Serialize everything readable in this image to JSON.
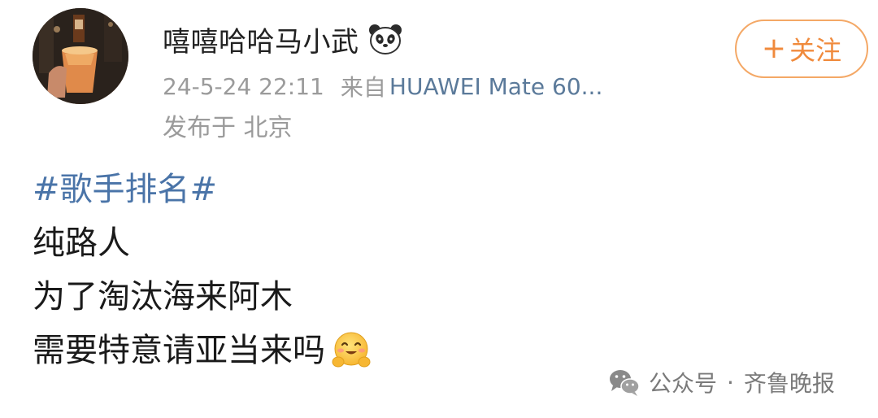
{
  "post": {
    "author": {
      "name": "嘻嘻哈哈马小武",
      "badge_icon": "panda-icon"
    },
    "time": "24-5-24 22:11",
    "source_prefix": "来自",
    "device": "HUAWEI Mate 60...",
    "location": "发布于 北京",
    "follow_button": {
      "plus": "+",
      "label": "关注"
    },
    "content": {
      "hashtag": "#歌手排名#",
      "lines": [
        "纯路人",
        "为了淘汰海来阿木",
        "需要特意请亚当来吗"
      ],
      "trailing_emoji": "hugging-face-emoji"
    }
  },
  "watermark": {
    "icon": "wechat-icon",
    "platform": "公众号",
    "separator": "·",
    "account": "齐鲁晚报"
  },
  "colors": {
    "hashtag": "#4a74a8",
    "device_link": "#5b7a9a",
    "follow_accent": "#f08a3c",
    "meta_gray": "#9b9b9b"
  }
}
